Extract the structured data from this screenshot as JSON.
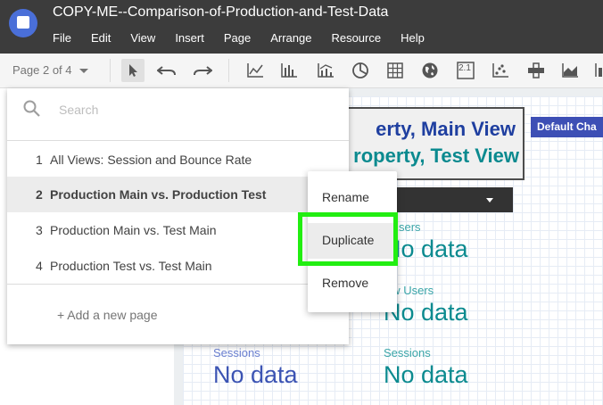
{
  "app": {
    "title": "COPY-ME--Comparison-of-Production-and-Test-Data",
    "logo_icon": "data-studio-logo-icon"
  },
  "menu": [
    "File",
    "Edit",
    "View",
    "Insert",
    "Page",
    "Arrange",
    "Resource",
    "Help"
  ],
  "toolbar": {
    "page_selector": "Page 2 of 4",
    "tools": [
      "select-pointer-icon",
      "undo-icon",
      "redo-icon",
      "time-series-icon",
      "bar-chart-icon",
      "combo-chart-icon",
      "pie-chart-icon",
      "table-icon",
      "geo-map-icon",
      "scorecard-icon",
      "scatter-icon",
      "pivot-icon",
      "area-chart-icon",
      "bullet-chart-icon"
    ],
    "scorecard_label": "2.1"
  },
  "pages_panel": {
    "search_placeholder": "Search",
    "pages": [
      {
        "num": "1",
        "label": "All Views: Session and Bounce Rate",
        "selected": false
      },
      {
        "num": "2",
        "label": "Production Main vs. Production Test",
        "selected": true
      },
      {
        "num": "3",
        "label": "Production Main vs. Test Main",
        "selected": false
      },
      {
        "num": "4",
        "label": "Production Test vs. Test Main",
        "selected": false
      }
    ],
    "add_page": "+ Add a new page"
  },
  "context_menu": {
    "items": [
      "Rename",
      "Duplicate",
      "Remove"
    ],
    "highlighted": "Duplicate"
  },
  "canvas": {
    "view_line1": "erty, Main View",
    "view_line2": "roperty, Test View",
    "default_button": "Default Cha",
    "metrics": [
      {
        "label": "sers",
        "value": "No data"
      },
      {
        "label": "ew Users",
        "value": "No data"
      },
      {
        "label": "Sessions",
        "value": "No data"
      },
      {
        "label": "Sessions",
        "value": "No data"
      }
    ]
  },
  "colors": {
    "topbar": "#3c3c3c",
    "blue_metric": "#3b53b3",
    "teal_metric": "#0b8a8f",
    "highlight": "#22ee11",
    "default_button": "#3d4fb5"
  }
}
